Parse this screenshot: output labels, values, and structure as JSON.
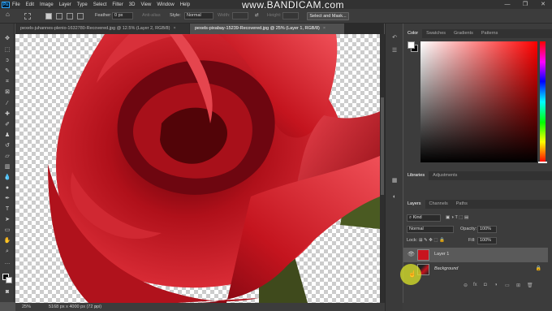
{
  "app": {
    "logo": "Ps",
    "watermark": "www.BANDICAM.com"
  },
  "menu": [
    "File",
    "Edit",
    "Image",
    "Layer",
    "Type",
    "Select",
    "Filter",
    "3D",
    "View",
    "Window",
    "Help"
  ],
  "window_controls": {
    "minimize": "—",
    "maximize": "❐",
    "close": "✕"
  },
  "options": {
    "feather_label": "Feather:",
    "feather_value": "0 px",
    "anti_alias": "Anti-alias",
    "style_label": "Style:",
    "style_value": "Normal",
    "width_label": "Width:",
    "height_label": "Height:",
    "swap": "⇄",
    "select_mask": "Select and Mask..."
  },
  "tabs": [
    {
      "label": "pexels-juhannes-plenio-1632780-Recovered.jpg @ 12.5% (Layer 2, RGB/8)",
      "close": "×"
    },
    {
      "label": "pexels-pixabay-15239-Recovered.jpg @ 25% (Layer 1, RGB/8)",
      "close": "×"
    }
  ],
  "status": {
    "zoom": "25%",
    "doc": "5168 px x 4000 px (72 ppi)",
    "arrow": "›"
  },
  "color_panel": {
    "tabs": [
      "Color",
      "Swatches",
      "Gradients",
      "Patterns"
    ],
    "fg": "#ffffff",
    "bg": "#000000"
  },
  "libraries_panel": {
    "tabs": [
      "Libraries",
      "Adjustments"
    ]
  },
  "layers_panel": {
    "tabs": [
      "Layers",
      "Channels",
      "Paths"
    ],
    "kind": "Kind",
    "blend_mode": "Normal",
    "opacity_label": "Opacity:",
    "opacity": "100%",
    "lock_label": "Lock:",
    "fill_label": "Fill:",
    "fill": "100%",
    "layers": [
      {
        "name": "Layer 1"
      },
      {
        "name": "Background"
      }
    ]
  },
  "icons": {
    "home": "home-icon",
    "marquee": "marquee-icon",
    "move": "move-icon",
    "lasso": "lasso-icon",
    "crop": "crop-icon",
    "brush": "brush-icon",
    "eraser": "eraser-icon",
    "type": "type-icon",
    "hand": "hand-icon",
    "zoom": "zoom-icon",
    "eye": "eye-icon",
    "lock": "lock-icon"
  },
  "colors": {
    "accent": "#31a8ff",
    "rose": "#c8141e",
    "cursor": "#dce628"
  }
}
